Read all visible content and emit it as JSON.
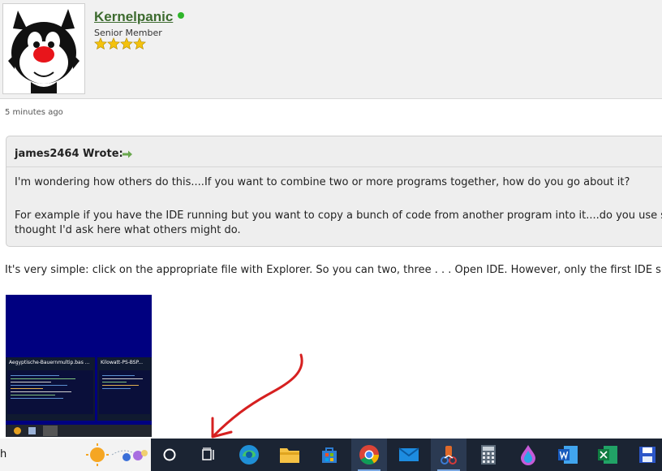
{
  "user": {
    "name": "Kernelpanic",
    "rank": "Senior Member",
    "stars": 4
  },
  "post": {
    "time": "5 minutes ago",
    "quote_author": "james2464 Wrote:",
    "quote_line1": "I'm wondering how others do this....If you want to combine two or more programs together, how do you go about it?",
    "quote_line2": "For example if you have the IDE running but you want to copy a bunch of code from another program into it....do you use somet",
    "quote_line3": "thought I'd ask here what others might do.",
    "reply": "It's very simple: click on the appropriate file with Explorer. So you can two, three . . . Open IDE. However, only the first IDE shows"
  },
  "screenshot": {
    "thumb1_title": "Aegyptische-Bauernmultip.bas ...",
    "thumb2_title": "Kilowatt-PS-BSP..."
  },
  "taskbar": {
    "search_text": "h",
    "icons": [
      "weather-icon",
      "cortana-icon",
      "task-view-icon",
      "edge-icon",
      "file-explorer-icon",
      "store-icon",
      "chrome-icon",
      "mail-icon",
      "qb64-icon",
      "calculator-icon",
      "paint-icon",
      "word-icon",
      "excel-icon",
      "save-icon"
    ]
  },
  "colors": {
    "username": "#3d6b2f",
    "taskbar": "#1b2433",
    "annotation_arrow": "#d62020"
  }
}
